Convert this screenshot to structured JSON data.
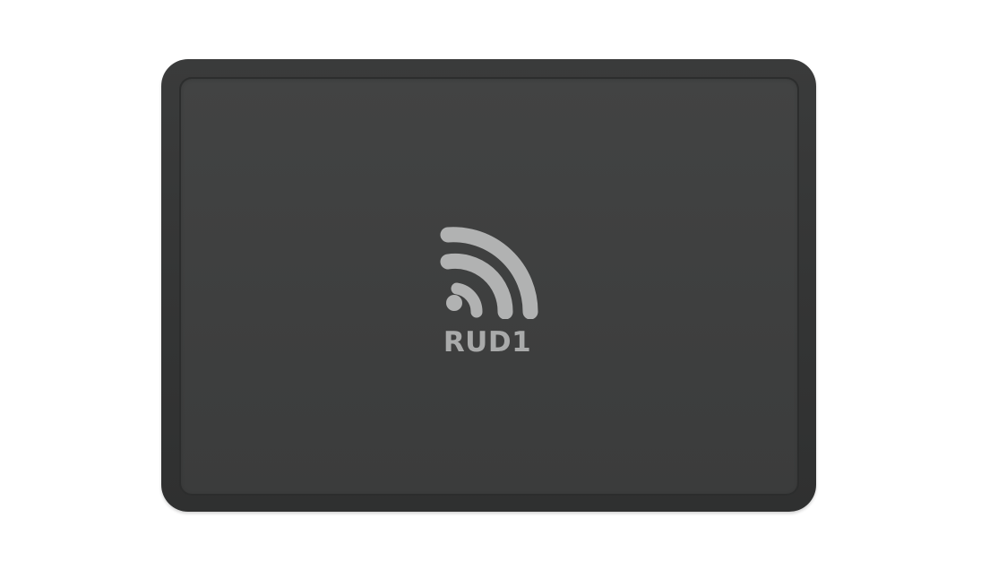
{
  "device": {
    "logo_text": "RUD1",
    "logo_icon": "wireless-signal-icon",
    "colors": {
      "background": "#ffffff",
      "device_body": "#3a3b3b",
      "device_face": "#414242",
      "logo": "#b1b2b2"
    }
  }
}
